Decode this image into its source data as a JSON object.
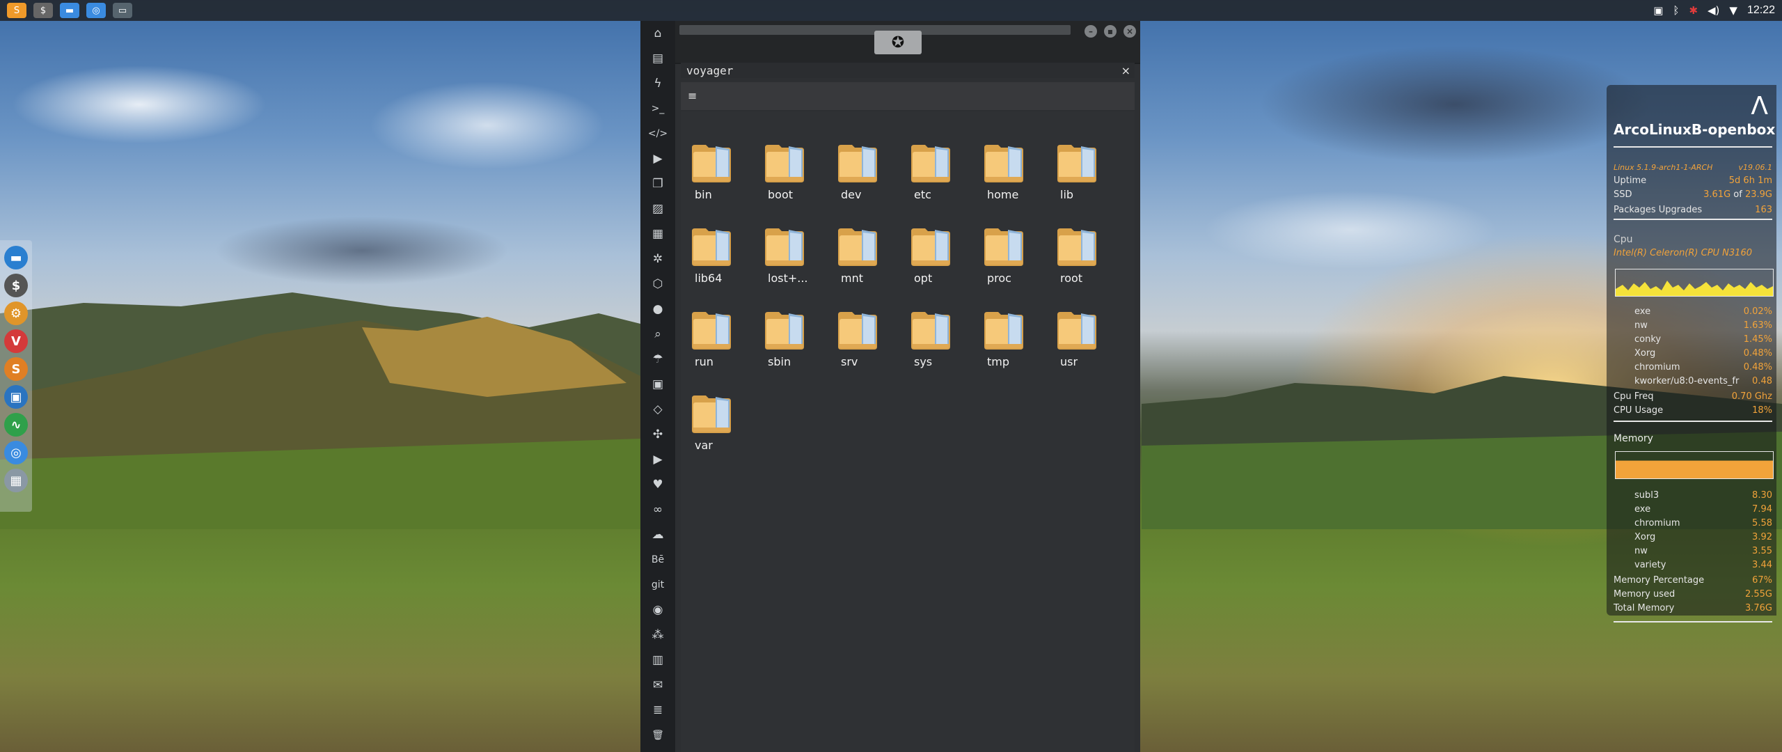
{
  "top_panel": {
    "apps": [
      {
        "icon": "sublime-text-icon",
        "glyph": "S",
        "color": "#f09a2a"
      },
      {
        "icon": "terminal-icon",
        "glyph": "$",
        "color": "#666"
      },
      {
        "icon": "files-icon",
        "glyph": "▬",
        "color": "#3a8be0"
      },
      {
        "icon": "chromium-icon",
        "glyph": "◎",
        "color": "#3a8be0"
      },
      {
        "icon": "workspace-icon",
        "glyph": "▭",
        "color": "#56646e"
      }
    ],
    "clock": "12:22"
  },
  "dock": {
    "items": [
      {
        "icon": "files-icon",
        "glyph": "▬",
        "color": "#2a7fd0"
      },
      {
        "icon": "terminal-icon",
        "glyph": "$",
        "color": "#555"
      },
      {
        "icon": "settings-icon",
        "glyph": "⚙",
        "color": "#e0952a"
      },
      {
        "icon": "vivaldi-icon",
        "glyph": "V",
        "color": "#d43a3a"
      },
      {
        "icon": "sublime-text-icon",
        "glyph": "S",
        "color": "#e07f24"
      },
      {
        "icon": "screenshot-icon",
        "glyph": "▣",
        "color": "#2a74c0"
      },
      {
        "icon": "system-monitor-icon",
        "glyph": "∿",
        "color": "#2fa04a"
      },
      {
        "icon": "chromium-icon",
        "glyph": "◎",
        "color": "#3a8be0"
      },
      {
        "icon": "workspaces-icon",
        "glyph": "▦",
        "color": "#8a98a4"
      }
    ]
  },
  "iconbar": [
    {
      "name": "home-icon",
      "glyph": "⌂"
    },
    {
      "name": "document-icon",
      "glyph": "▤"
    },
    {
      "name": "bolt-icon",
      "glyph": "ϟ"
    },
    {
      "name": "terminal-prompt-icon",
      "glyph": ">_"
    },
    {
      "name": "code-icon",
      "glyph": "</>"
    },
    {
      "name": "play-icon",
      "glyph": "▶"
    },
    {
      "name": "copy-icon",
      "glyph": "❐"
    },
    {
      "name": "image-icon",
      "glyph": "▨"
    },
    {
      "name": "newspaper-icon",
      "glyph": "▦"
    },
    {
      "name": "gear-icon",
      "glyph": "✲"
    },
    {
      "name": "hexagon-icon",
      "glyph": "⬡"
    },
    {
      "name": "globe-icon",
      "glyph": "●"
    },
    {
      "name": "search-icon",
      "glyph": "⌕"
    },
    {
      "name": "umbrella-icon",
      "glyph": "☂"
    },
    {
      "name": "contact-icon",
      "glyph": "▣"
    },
    {
      "name": "diamond-icon",
      "glyph": "◇"
    },
    {
      "name": "expand-icon",
      "glyph": "✣"
    },
    {
      "name": "youtube-icon",
      "glyph": "▶"
    },
    {
      "name": "heart-icon",
      "glyph": "♥"
    },
    {
      "name": "infinity-icon",
      "glyph": "∞"
    },
    {
      "name": "cloud-icon",
      "glyph": "☁"
    },
    {
      "name": "behance-icon",
      "glyph": "Bē"
    },
    {
      "name": "git-icon",
      "glyph": "git"
    },
    {
      "name": "github-icon",
      "glyph": "◉"
    },
    {
      "name": "cubes-icon",
      "glyph": "⁂"
    },
    {
      "name": "map-icon",
      "glyph": "▥"
    },
    {
      "name": "envelope-icon",
      "glyph": "✉"
    },
    {
      "name": "server-icon",
      "glyph": "≣"
    },
    {
      "name": "trash-icon",
      "glyph": "🗑"
    }
  ],
  "window": {
    "logo_icon": "rebel-alliance-icon",
    "logo_glyph": "✪",
    "pane_title": "voyager",
    "pane_close": "×",
    "menu_glyph": "≡",
    "folders": [
      "bin",
      "boot",
      "dev",
      "etc",
      "home",
      "lib",
      "lib64",
      "lost+...",
      "mnt",
      "opt",
      "proc",
      "root",
      "run",
      "sbin",
      "srv",
      "sys",
      "tmp",
      "usr",
      "var"
    ]
  },
  "conky": {
    "logo_glyph": "Λ",
    "hostname": "ArcoLinuxB-openbox",
    "kernel": "Linux 5.1.9-arch1-1-ARCH",
    "version": "v19.06.1",
    "uptime_label": "Uptime",
    "uptime_value": "5d 6h 1m",
    "ssd_label": "SSD",
    "ssd_used": "3.61G",
    "ssd_of": "of",
    "ssd_total": "23.9G",
    "packages_label": "Packages Upgrades",
    "packages_value": "163",
    "cpu_label": "Cpu",
    "cpu_model": "Intel(R) Celeron(R) CPU  N3160",
    "cpu_procs": [
      {
        "name": "exe",
        "value": "0.02%"
      },
      {
        "name": "nw",
        "value": "1.63%"
      },
      {
        "name": "conky",
        "value": "1.45%"
      },
      {
        "name": "Xorg",
        "value": "0.48%"
      },
      {
        "name": "chromium",
        "value": "0.48%"
      },
      {
        "name": "kworker/u8:0-events_fr",
        "value": "0.48"
      }
    ],
    "cpu_freq_label": "Cpu Freq",
    "cpu_freq_value": "0.70 Ghz",
    "cpu_usage_label": "CPU Usage",
    "cpu_usage_value": "18%",
    "memory_label": "Memory",
    "mem_procs": [
      {
        "name": "subl3",
        "value": "8.30"
      },
      {
        "name": "exe",
        "value": "7.94"
      },
      {
        "name": "chromium",
        "value": "5.58"
      },
      {
        "name": "Xorg",
        "value": "3.92"
      },
      {
        "name": "nw",
        "value": "3.55"
      },
      {
        "name": "variety",
        "value": "3.44"
      }
    ],
    "mem_pct_label": "Memory Percentage",
    "mem_pct_value": "67%",
    "mem_used_label": "Memory used",
    "mem_used_value": "2.55G",
    "mem_total_label": "Total Memory",
    "mem_total_value": "3.76G",
    "accent": "#f2a33a",
    "graph_color": "#f5e23a"
  }
}
